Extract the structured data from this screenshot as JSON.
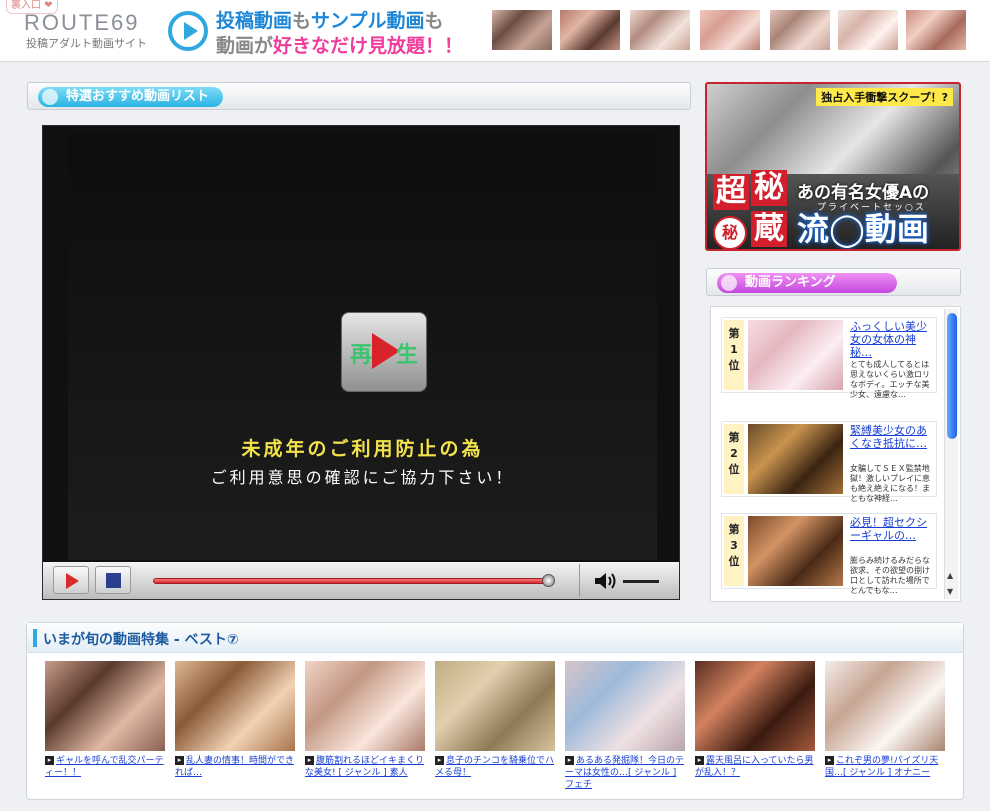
{
  "header": {
    "top_link": "裏入口 ❤",
    "logo": "ROUTE69",
    "logo_sub": "投稿アダルト動画サイト",
    "tagline": {
      "l1_a": "投稿動画",
      "l1_b": "も",
      "l1_c": "サンプル動画",
      "l1_d": "も",
      "l2_a": "動画が",
      "l2_b": "好きなだけ見放題！！"
    }
  },
  "featured": {
    "title": "特選おすすめ動画リスト"
  },
  "player": {
    "play_kana_1": "再",
    "play_kana_2": "生",
    "warning_1": "未成年のご利用防止の為",
    "warning_2": "ご利用意思の確認にご協力下さい！"
  },
  "banner": {
    "scoop": "独占入手衝撃スクープ！?",
    "cho": "超",
    "hi": "秘",
    "maru": "秘",
    "zo": "蔵",
    "text1": "あの有名女優Aの",
    "text2": "プライベートセッ○ス",
    "text3": "流◯動画"
  },
  "ranking": {
    "title": "動画ランキング",
    "items": [
      {
        "num": "第\n1\n位",
        "title": "ふっくしい美少女の女体の神秘…",
        "desc": "とても成人してるとは思えないくらい激ロリなボディ。エッチな美少女、遠慮な…"
      },
      {
        "num": "第\n2\n位",
        "title": "緊縛美少女のあくなき抵抗に…",
        "desc": "女騙してＳＥＸ監禁地獄！激しいプレイに息も絶え絶えになる！まともな神経…"
      },
      {
        "num": "第\n3\n位",
        "title": "必見！超セクシーギャルの…",
        "desc": "膨らみ続けるみだらな欲求、その欲望の捌け口として訪れた場所でとんでもな…"
      }
    ]
  },
  "best": {
    "title": "いまが旬の動画特集 - ベスト⑦",
    "items": [
      {
        "caption": "ギャルを呼んで乱交パーティー！！"
      },
      {
        "caption": "乱人妻の情事！時間ができれば…"
      },
      {
        "caption": "腹筋割れるほどイキまくりな美女! [ ジャンル ] 素人"
      },
      {
        "caption": "息子のチンコを騎乗位でハメる母！"
      },
      {
        "caption": "あるある発掘隊！今日のテーマは女性の…[ ジャンル ] フェチ"
      },
      {
        "caption": "露天風呂に入っていたら男が乱入！？"
      },
      {
        "caption": "これぞ男の夢!パイズリ天国…[ ジャンル ] オナニー"
      }
    ]
  },
  "colors": {
    "accent_cyan": "#2cb3e4",
    "accent_magenta": "#c347dd",
    "link_blue": "#1a3fd6",
    "banner_red": "#d21f2b"
  }
}
